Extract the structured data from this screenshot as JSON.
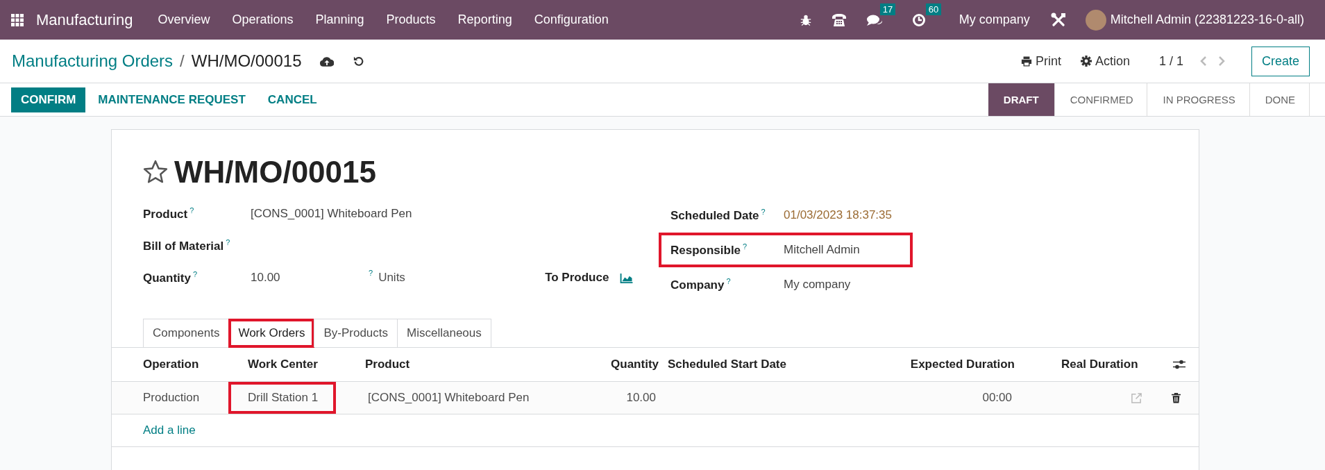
{
  "navbar": {
    "app_name": "Manufacturing",
    "menu": [
      "Overview",
      "Operations",
      "Planning",
      "Products",
      "Reporting",
      "Configuration"
    ],
    "messages_count": "17",
    "activities_count": "60",
    "company": "My company",
    "user": "Mitchell Admin (22381223-16-0-all)"
  },
  "breadcrumb": {
    "parent": "Manufacturing Orders",
    "separator": "/",
    "current": "WH/MO/00015"
  },
  "control_panel": {
    "print": "Print",
    "action": "Action",
    "pager": "1 / 1",
    "create": "Create"
  },
  "buttons": [
    {
      "label": "CONFIRM",
      "kind": "primary"
    },
    {
      "label": "MAINTENANCE REQUEST",
      "kind": "secondary"
    },
    {
      "label": "CANCEL",
      "kind": "secondary"
    }
  ],
  "stages": [
    {
      "label": "DRAFT",
      "selected": true
    },
    {
      "label": "CONFIRMED",
      "selected": false
    },
    {
      "label": "IN PROGRESS",
      "selected": false
    },
    {
      "label": "DONE",
      "selected": false
    }
  ],
  "record": {
    "title": "WH/MO/00015",
    "left_fields": [
      {
        "label": "Product",
        "help": "?",
        "value": "[CONS_0001] Whiteboard Pen"
      },
      {
        "label": "Bill of Material",
        "help": "?"
      },
      {
        "label": "Quantity",
        "help": "?",
        "value": "10.00",
        "unit_help": "?",
        "unit": "Units"
      }
    ],
    "to_produce": "To Produce",
    "right_fields": [
      {
        "label": "Scheduled Date",
        "help": "?",
        "value": "01/03/2023 18:37:35",
        "kind": "date",
        "highlighted": false
      },
      {
        "label": "Responsible",
        "help": "?",
        "value": "Mitchell Admin",
        "kind": "text",
        "highlighted": true
      },
      {
        "label": "Company",
        "help": "?",
        "value": "My company",
        "kind": "text",
        "highlighted": false
      }
    ]
  },
  "tabs": [
    {
      "label": "Components",
      "selected": false,
      "highlighted": false
    },
    {
      "label": "Work Orders",
      "selected": true,
      "highlighted": true
    },
    {
      "label": "By-Products",
      "selected": false,
      "highlighted": false
    },
    {
      "label": "Miscellaneous",
      "selected": false,
      "highlighted": false
    }
  ],
  "table": {
    "columns": [
      "Operation",
      "Work Center",
      "Product",
      "Quantity",
      "Scheduled Start Date",
      "Expected Duration",
      "Real Duration"
    ],
    "rows": [
      {
        "cells": [
          {
            "text": "Production",
            "highlighted": false
          },
          {
            "text": "Drill Station 1",
            "highlighted": true
          },
          {
            "text": "[CONS_0001] Whiteboard Pen",
            "highlighted": false
          },
          {
            "text": "10.00",
            "highlighted": false
          },
          {
            "highlighted": false
          },
          {
            "text": "00:00",
            "highlighted": false
          },
          {
            "highlighted": false
          }
        ]
      }
    ],
    "add_line": "Add a line"
  }
}
